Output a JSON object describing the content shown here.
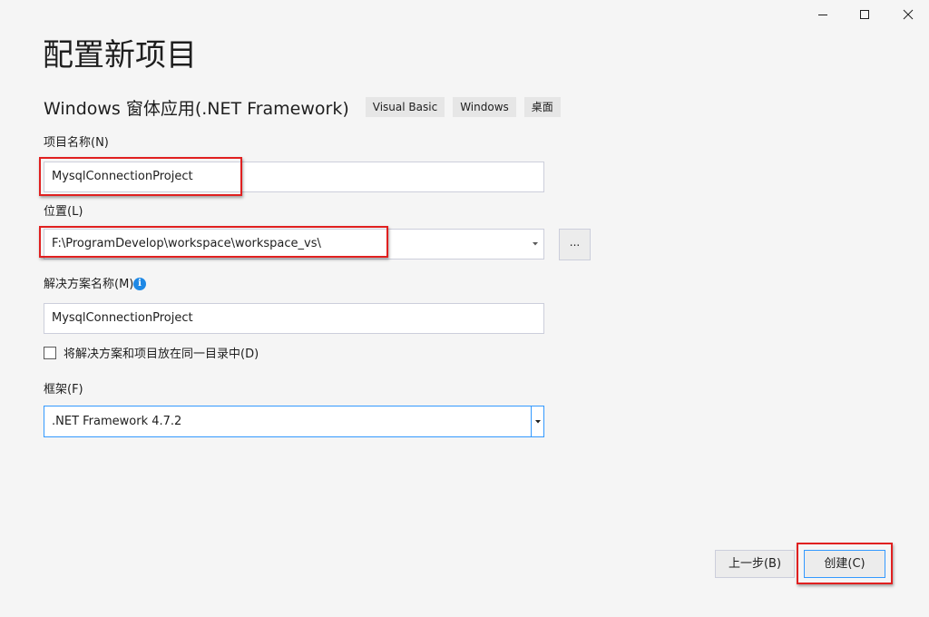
{
  "window_controls": {
    "minimize_icon": "minimize-icon",
    "maximize_icon": "maximize-icon",
    "close_icon": "close-icon"
  },
  "title": "配置新项目",
  "template": {
    "name": "Windows 窗体应用(.NET Framework)",
    "tags": [
      "Visual Basic",
      "Windows",
      "桌面"
    ]
  },
  "project_name": {
    "label": "项目名称(N)",
    "value": "MysqlConnectionProject"
  },
  "location": {
    "label": "位置(L)",
    "value": "F:\\ProgramDevelop\\workspace\\workspace_vs\\",
    "browse_label": "..."
  },
  "solution_name": {
    "label": "解决方案名称(M)",
    "value": "MysqlConnectionProject",
    "info_glyph": "i"
  },
  "same_directory": {
    "label": "将解决方案和项目放在同一目录中(D)",
    "checked": false
  },
  "framework": {
    "label": "框架(F)",
    "value": ".NET Framework 4.7.2"
  },
  "buttons": {
    "back": "上一步(B)",
    "create": "创建(C)"
  },
  "colors": {
    "background": "#f5f5f5",
    "accent": "#3399ff",
    "highlight": "#e02020",
    "info": "#1e88e5"
  }
}
